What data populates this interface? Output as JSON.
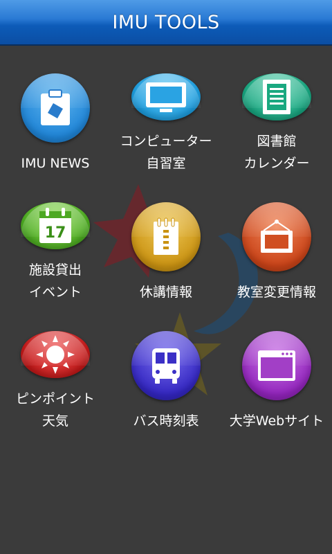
{
  "header": {
    "title": "IMU TOOLS"
  },
  "tiles": [
    {
      "line1": "IMU NEWS",
      "line2": "",
      "color": "#2a93e0",
      "icon": "clipboard-icon"
    },
    {
      "line1": "コンピューター",
      "line2": "自習室",
      "color": "#2aa6e6",
      "icon": "monitor-icon"
    },
    {
      "line1": "図書館",
      "line2": "カレンダー",
      "color": "#1fb28c",
      "icon": "book-icon"
    },
    {
      "line1": "施設貸出",
      "line2": "イベント",
      "color": "#5cc02e",
      "icon": "calendar-icon"
    },
    {
      "line1": "休講情報",
      "line2": "",
      "color": "#d8a418",
      "icon": "notebook-icon"
    },
    {
      "line1": "教室変更情報",
      "line2": "",
      "color": "#dc5a2e",
      "icon": "signboard-icon"
    },
    {
      "line1": "ピンポイント",
      "line2": "天気",
      "color": "#d62a2a",
      "icon": "sun-icon"
    },
    {
      "line1": "バス時刻表",
      "line2": "",
      "color": "#4a3fd0",
      "icon": "bus-icon"
    },
    {
      "line1": "大学Webサイト",
      "line2": "",
      "color": "#a740c9",
      "icon": "browser-window-icon"
    }
  ],
  "calendar_icon_day": "17"
}
